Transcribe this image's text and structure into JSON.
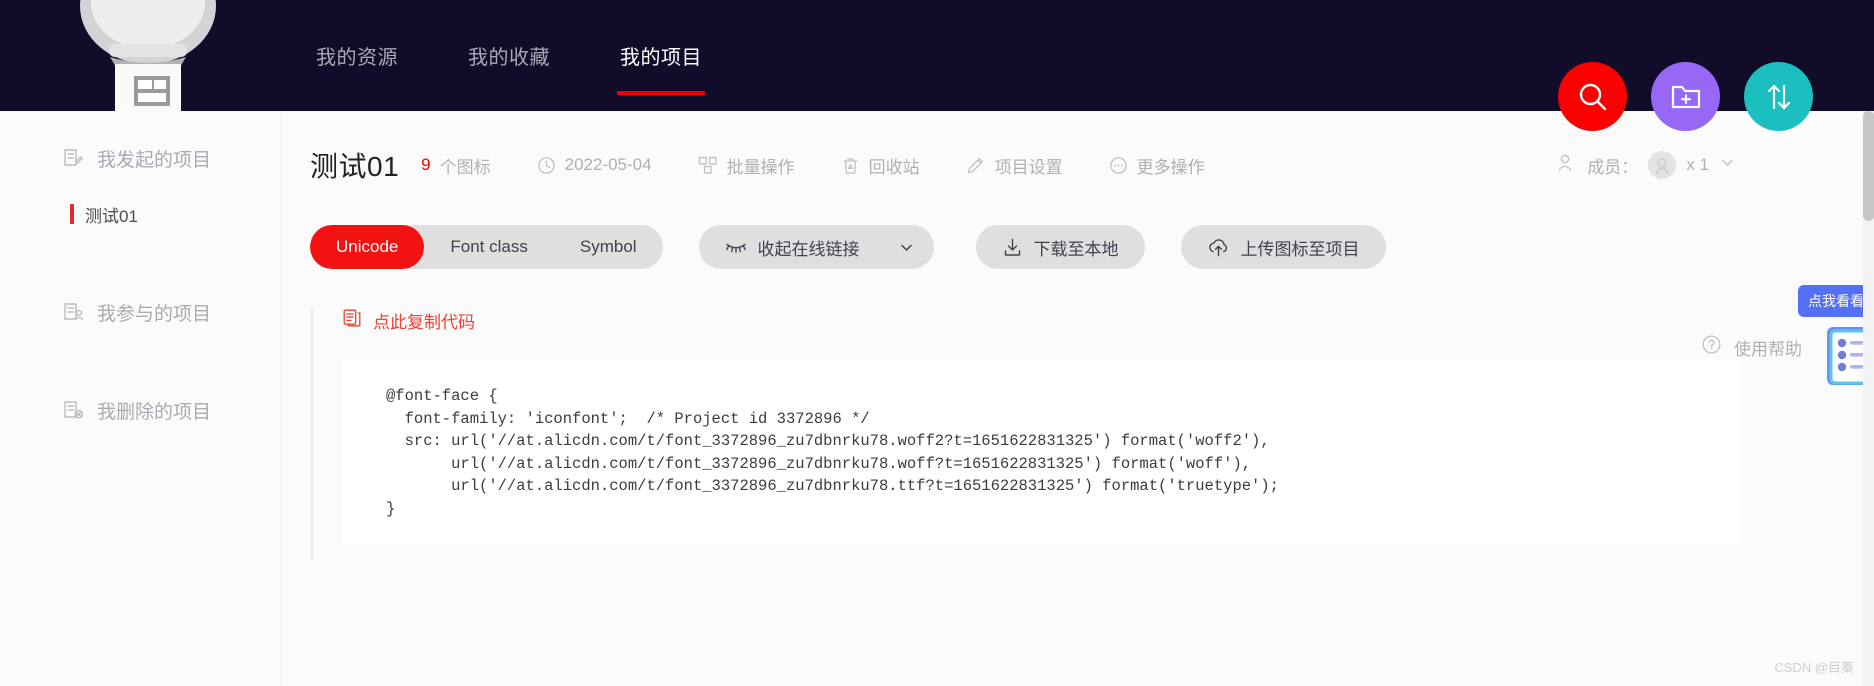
{
  "header": {
    "logo_name": "gumball-machine-logo",
    "nav": [
      {
        "label": "我的资源",
        "active": false
      },
      {
        "label": "我的收藏",
        "active": false
      },
      {
        "label": "我的项目",
        "active": true
      }
    ],
    "actions": [
      {
        "name": "search-icon",
        "label": "搜索",
        "color": "#fc0000"
      },
      {
        "name": "new-folder-icon",
        "label": "新建项目",
        "color": "#9668f5"
      },
      {
        "name": "sort-icon",
        "label": "排序",
        "color": "#1bbfbf"
      }
    ]
  },
  "sidebar": {
    "items": [
      {
        "label": "我发起的项目",
        "icon": "project-created-icon"
      },
      {
        "label": "我参与的项目",
        "icon": "project-joined-icon"
      },
      {
        "label": "我删除的项目",
        "icon": "project-deleted-icon"
      }
    ],
    "sub_item": {
      "label": "测试01",
      "selected": true,
      "accent": "#e8252a"
    }
  },
  "project": {
    "title": "测试01",
    "icon_count": "9",
    "icon_count_label": "个图标",
    "date": "2022-05-04",
    "actions": [
      {
        "label": "批量操作",
        "icon": "batch-operation-icon"
      },
      {
        "label": "回收站",
        "icon": "trash-icon"
      },
      {
        "label": "项目设置",
        "icon": "pencil-icon"
      },
      {
        "label": "更多操作",
        "icon": "ellipsis-circle-icon"
      }
    ],
    "members": {
      "label": "成员：",
      "count": "x 1",
      "chevron": "chevron-down-icon"
    }
  },
  "toolbar": {
    "segments": [
      {
        "label": "Unicode",
        "active": true
      },
      {
        "label": "Font class",
        "active": false
      },
      {
        "label": "Symbol",
        "active": false
      }
    ],
    "active_color": "#f31212",
    "collapse_link": {
      "label": "收起在线链接",
      "icon": "eye-closed-icon",
      "chevron": "chevron-down-icon"
    },
    "download": {
      "label": "下载至本地",
      "icon": "download-icon"
    },
    "upload": {
      "label": "上传图标至项目",
      "icon": "cloud-upload-icon"
    },
    "help": {
      "label": "使用帮助",
      "icon": "question-circle-icon"
    }
  },
  "code_section": {
    "copy_label": "点此复制代码",
    "copy_icon": "copy-icon",
    "copy_color": "#f04134",
    "code": "@font-face {\n  font-family: 'iconfont';  /* Project id 3372896 */\n  src: url('//at.alicdn.com/t/font_3372896_zu7dbnrku78.woff2?t=1651622831325') format('woff2'),\n       url('//at.alicdn.com/t/font_3372896_zu7dbnrku78.woff?t=1651622831325') format('woff'),\n       url('//at.alicdn.com/t/font_3372896_zu7dbnrku78.ttf?t=1651622831325') format('truetype');\n}"
  },
  "floating_tip": {
    "label": "点我看看",
    "icon": "checklist-icon",
    "color": "#5470f5"
  },
  "watermark": "CSDN @目蓁"
}
